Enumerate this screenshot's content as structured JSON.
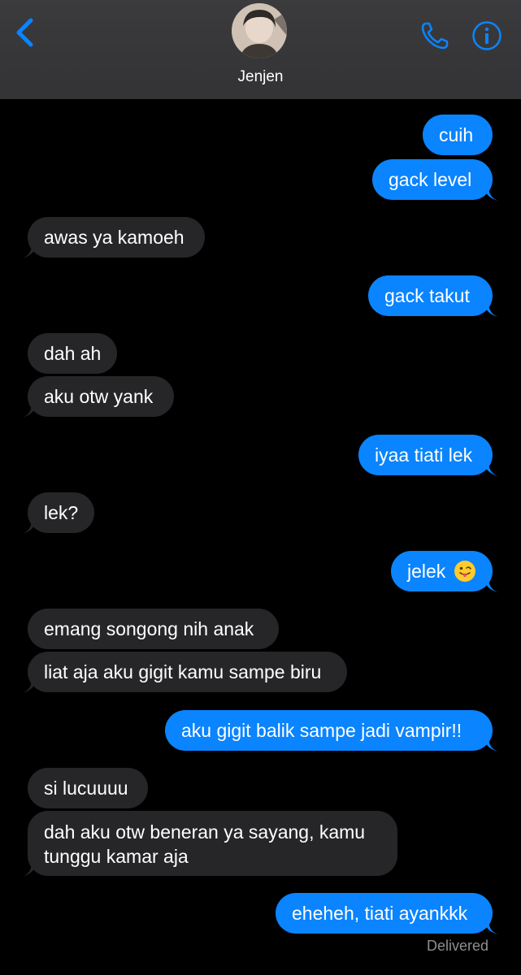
{
  "header": {
    "contact_name": "Jenjen"
  },
  "messages": [
    {
      "text": "cuih",
      "direction": "outgoing"
    },
    {
      "text": "gack level",
      "direction": "outgoing"
    },
    {
      "text": "awas ya kamoeh",
      "direction": "incoming"
    },
    {
      "text": "gack takut",
      "direction": "outgoing"
    },
    {
      "text": "dah ah",
      "direction": "incoming"
    },
    {
      "text": "aku otw yank",
      "direction": "incoming"
    },
    {
      "text": "iyaa tiati lek",
      "direction": "outgoing"
    },
    {
      "text": "lek?",
      "direction": "incoming"
    },
    {
      "text": "jelek",
      "direction": "outgoing",
      "emoji": "tongue-out-emoji"
    },
    {
      "text": "emang songong nih anak",
      "direction": "incoming"
    },
    {
      "text": "liat aja aku gigit kamu sampe biru",
      "direction": "incoming"
    },
    {
      "text": "aku gigit balik sampe jadi vampir!!",
      "direction": "outgoing"
    },
    {
      "text": "si lucuuuu",
      "direction": "incoming"
    },
    {
      "text": "dah aku otw beneran ya sayang, kamu tunggu kamar aja",
      "direction": "incoming"
    },
    {
      "text": "eheheh, tiati ayankkk",
      "direction": "outgoing"
    }
  ],
  "status": {
    "delivered": "Delivered"
  },
  "colors": {
    "outgoing_bubble": "#0a84ff",
    "incoming_bubble": "#262628",
    "accent": "#0a84ff",
    "background": "#000000"
  }
}
